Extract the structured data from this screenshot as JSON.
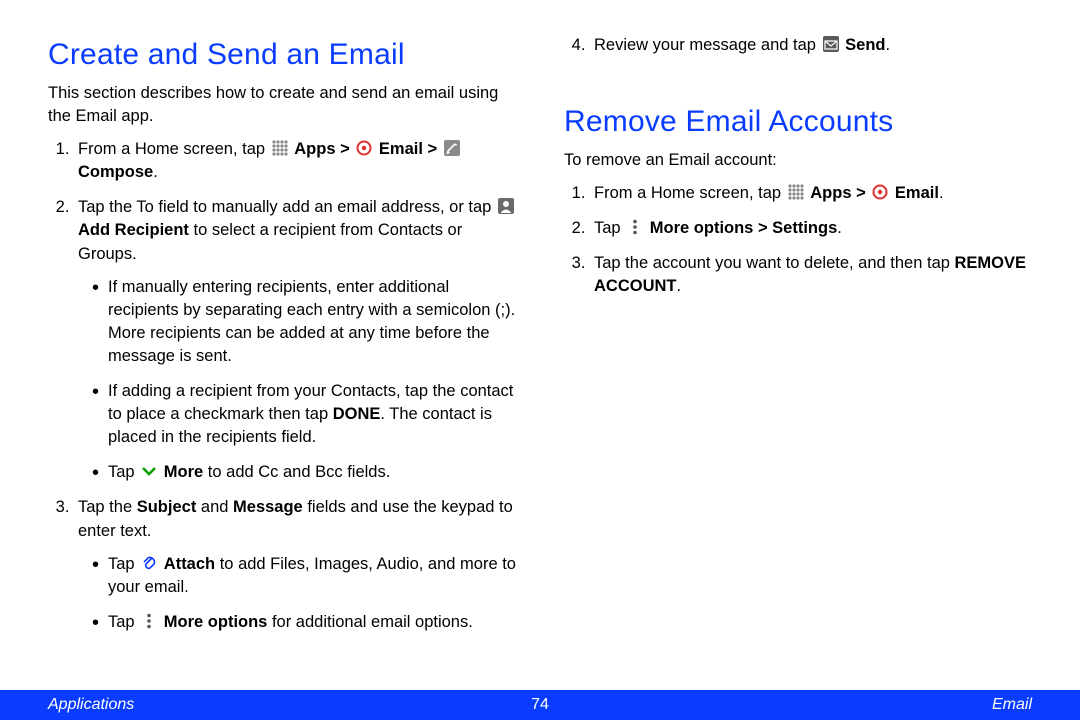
{
  "s1": {
    "title": "Create and Send an Email",
    "intro": "This section describes how to create and send an email using the Email app.",
    "step1": {
      "a": "From a Home screen, tap ",
      "b": " Apps > ",
      "c": " Email > ",
      "d": " Compose"
    },
    "step2": {
      "a": "Tap the To field to manually add an email address, or tap ",
      "b": " Add Recipient",
      "c": " to select a recipient from Contacts or Groups.",
      "bul1": "If manually entering recipients, enter additional recipients by separating each entry with a semicolon (;). More recipients can be added at any time before the message is sent.",
      "bul2a": "If adding a recipient from your Contacts, tap the contact to place a checkmark then tap ",
      "bul2b": "DONE",
      "bul2c": ". The contact is placed in the recipients field.",
      "bul3a": "Tap ",
      "bul3b": " More",
      "bul3c": " to add Cc and Bcc fields."
    },
    "step3": {
      "a": "Tap the ",
      "b": "Subject",
      "c": " and ",
      "d": "Message",
      "e": " fields and use the keypad to enter text.",
      "bul1a": "Tap ",
      "bul1b": " Attach",
      "bul1c": " to add Files, Images, Audio, and more to your email.",
      "bul2a": "Tap ",
      "bul2b": " More options",
      "bul2c": " for additional email options."
    },
    "step4": {
      "a": "Review your message and tap ",
      "b": " Send",
      "c": "."
    }
  },
  "s2": {
    "title": "Remove Email Accounts",
    "intro": "To remove an Email account:",
    "step1": {
      "a": "From a Home screen, tap ",
      "b": " Apps > ",
      "c": " Email",
      "d": "."
    },
    "step2": {
      "a": "Tap ",
      "b": " More options > Settings",
      "c": "."
    },
    "step3": {
      "a": "Tap the account you want to delete, and then tap ",
      "b": "REMOVE ACCOUNT",
      "c": "."
    }
  },
  "footer": {
    "left": "Applications",
    "page": "74",
    "right": "Email"
  }
}
